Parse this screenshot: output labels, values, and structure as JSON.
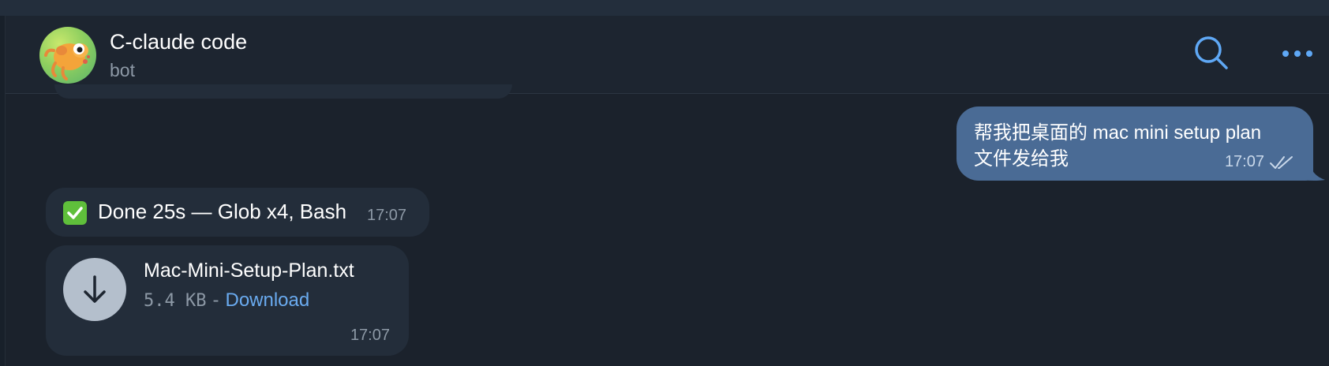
{
  "header": {
    "title": "C-claude code",
    "subtitle": "bot",
    "avatar_icon": "cartoon-creature-avatar",
    "search_icon": "search-icon",
    "more_icon": "more-dots-icon",
    "accent_color": "#5fa8f5"
  },
  "messages": [
    {
      "direction": "outgoing",
      "text_line1": "帮我把桌面的 mac mini setup plan",
      "text_line2": "文件发给我",
      "time": "17:07",
      "status_icon": "double-check-icon",
      "bubble_color": "#4a6b95"
    },
    {
      "direction": "incoming",
      "emoji": "check-mark-button-icon",
      "text": "Done 25s — Glob x4, Bash",
      "time": "17:07"
    },
    {
      "direction": "incoming",
      "type": "file",
      "file_name": "Mac-Mini-Setup-Plan.txt",
      "file_size": "5.4 KB",
      "separator": "-",
      "download_label": "Download",
      "download_icon": "download-arrow-icon",
      "time": "17:07"
    }
  ]
}
